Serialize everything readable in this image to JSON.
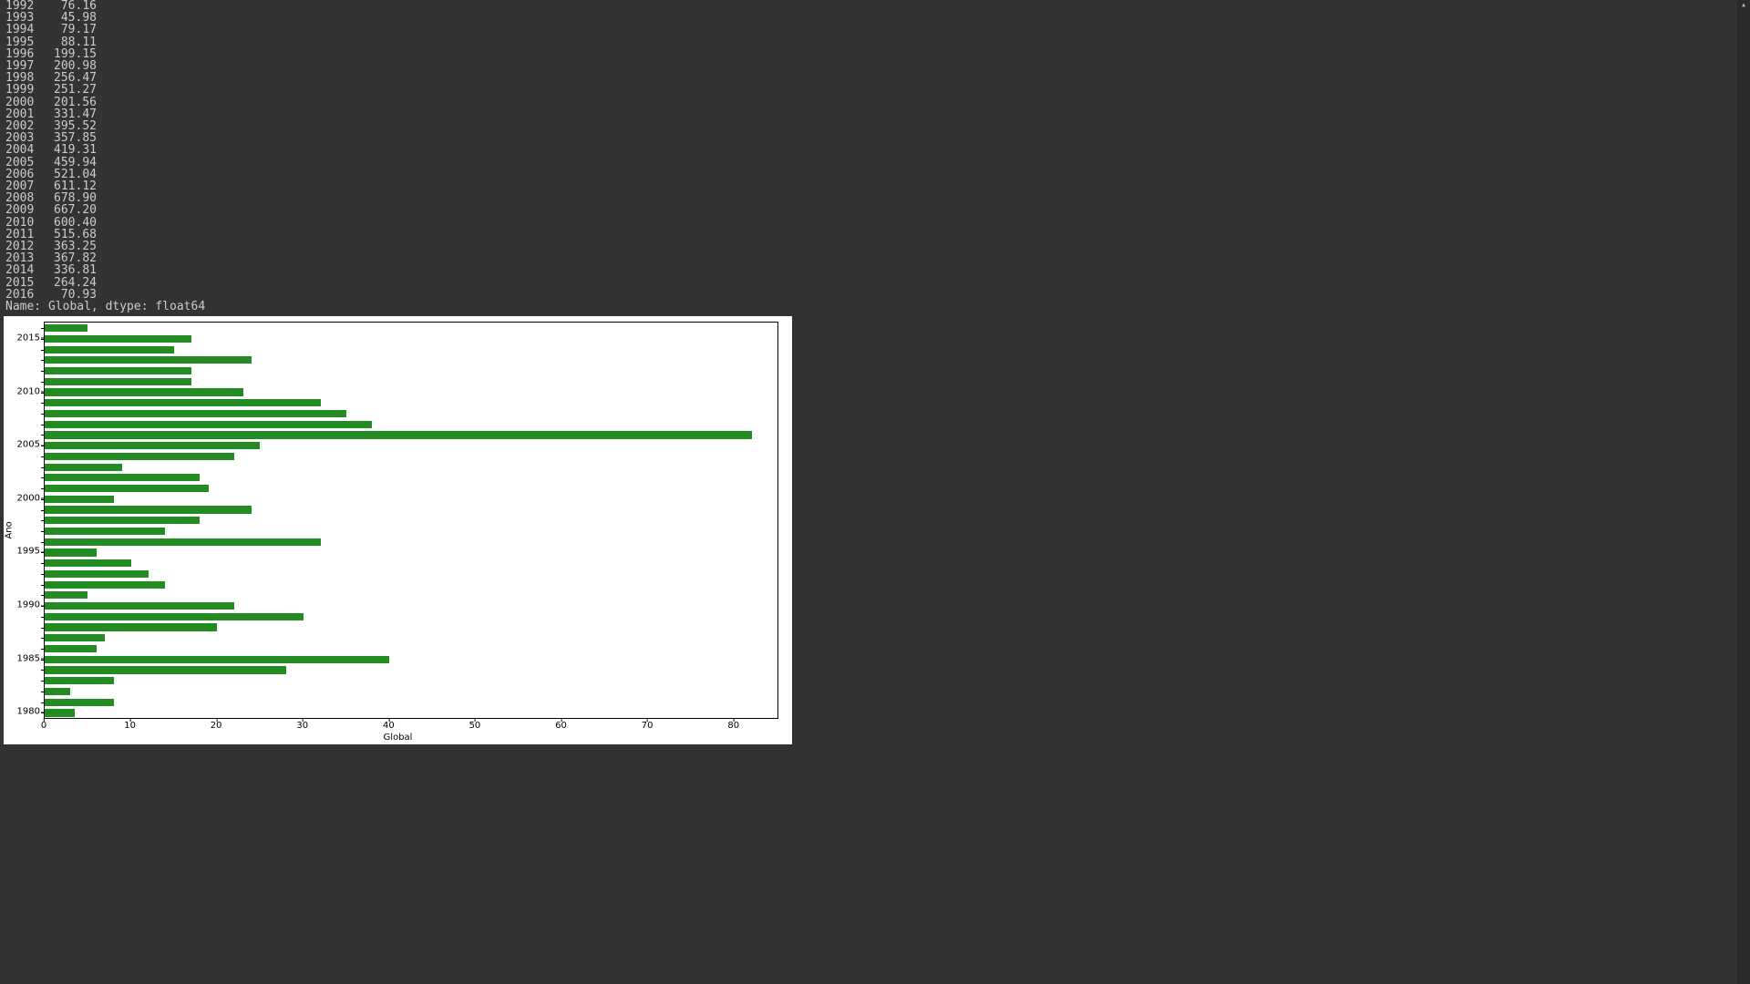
{
  "output_rows": [
    {
      "year": "1992",
      "value": "76.16"
    },
    {
      "year": "1993",
      "value": "45.98"
    },
    {
      "year": "1994",
      "value": "79.17"
    },
    {
      "year": "1995",
      "value": "88.11"
    },
    {
      "year": "1996",
      "value": "199.15"
    },
    {
      "year": "1997",
      "value": "200.98"
    },
    {
      "year": "1998",
      "value": "256.47"
    },
    {
      "year": "1999",
      "value": "251.27"
    },
    {
      "year": "2000",
      "value": "201.56"
    },
    {
      "year": "2001",
      "value": "331.47"
    },
    {
      "year": "2002",
      "value": "395.52"
    },
    {
      "year": "2003",
      "value": "357.85"
    },
    {
      "year": "2004",
      "value": "419.31"
    },
    {
      "year": "2005",
      "value": "459.94"
    },
    {
      "year": "2006",
      "value": "521.04"
    },
    {
      "year": "2007",
      "value": "611.12"
    },
    {
      "year": "2008",
      "value": "678.90"
    },
    {
      "year": "2009",
      "value": "667.20"
    },
    {
      "year": "2010",
      "value": "600.40"
    },
    {
      "year": "2011",
      "value": "515.68"
    },
    {
      "year": "2012",
      "value": "363.25"
    },
    {
      "year": "2013",
      "value": "367.82"
    },
    {
      "year": "2014",
      "value": "336.81"
    },
    {
      "year": "2015",
      "value": "264.24"
    },
    {
      "year": "2016",
      "value": "70.93"
    }
  ],
  "dtype_line": "Name: Global, dtype: float64",
  "chart_data": {
    "type": "barh",
    "xlabel": "Global",
    "ylabel": "Ano",
    "xlim": [
      0,
      85
    ],
    "ylim_years": [
      1980,
      2016
    ],
    "xticks": [
      0,
      10,
      20,
      30,
      40,
      50,
      60,
      70,
      80
    ],
    "yticks": [
      1980,
      1985,
      1990,
      1995,
      2000,
      2005,
      2010,
      2015
    ],
    "bar_color": "green",
    "categories": [
      1980,
      1981,
      1982,
      1983,
      1984,
      1985,
      1986,
      1987,
      1988,
      1989,
      1990,
      1991,
      1992,
      1993,
      1994,
      1995,
      1996,
      1997,
      1998,
      1999,
      2000,
      2001,
      2002,
      2003,
      2004,
      2005,
      2006,
      2007,
      2008,
      2009,
      2010,
      2011,
      2012,
      2013,
      2014,
      2015,
      2016
    ],
    "values": [
      3.5,
      8,
      3,
      8,
      28,
      40,
      6,
      7,
      20,
      30,
      22,
      5,
      14,
      12,
      10,
      6,
      32,
      14,
      18,
      24,
      8,
      19,
      18,
      9,
      22,
      25,
      82,
      38,
      35,
      32,
      23,
      17,
      17,
      24,
      15,
      17,
      5
    ],
    "notes": "Horizontal bar chart; years increase downward→upward visually with 2016 at top. Values are visual estimates read off gridlines (approx)."
  }
}
